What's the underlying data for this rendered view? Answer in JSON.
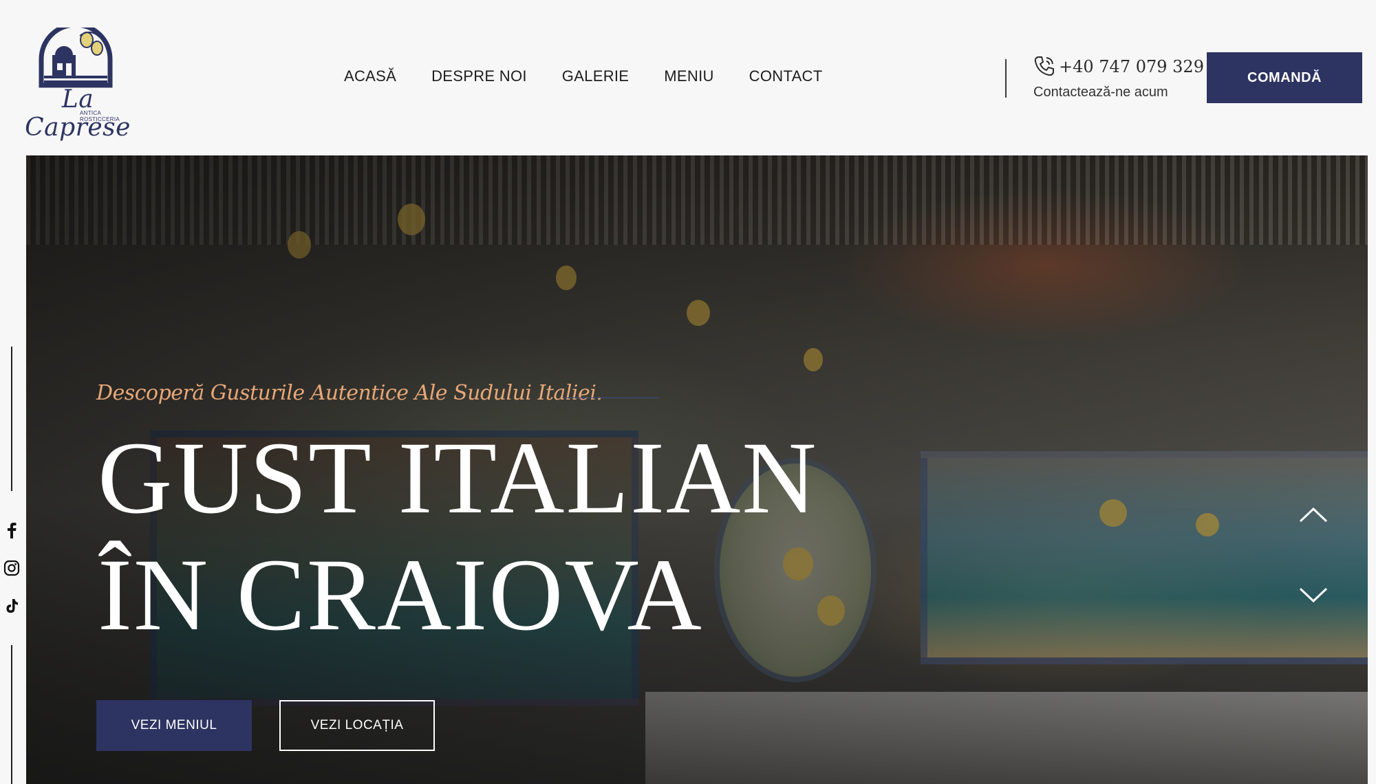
{
  "header": {
    "logo": {
      "brand": "La Caprese",
      "sub": "ANTICA ROSTICCERIA",
      "icon": "lemon-house-emblem"
    },
    "nav": [
      {
        "label": "ACASĂ"
      },
      {
        "label": "DESPRE NOI"
      },
      {
        "label": "GALERIE"
      },
      {
        "label": "MENIU"
      },
      {
        "label": "CONTACT"
      }
    ],
    "contact": {
      "phone": "+40 747 079 329",
      "subtitle": "Contactează-ne acum",
      "icon": "phone-icon"
    },
    "order_button": "COMANDĂ"
  },
  "social": [
    {
      "icon": "facebook-icon"
    },
    {
      "icon": "instagram-icon"
    },
    {
      "icon": "tiktok-icon"
    }
  ],
  "hero": {
    "tagline": "Descoperă Gusturile Autentice Ale Sudului Italiei.",
    "headline_line1": "GUST ITALIAN",
    "headline_line2": "ÎN CRAIOVA",
    "primary_button": "VEZI MENIUL",
    "secondary_button": "VEZI LOCAȚIA",
    "controls": {
      "up": "chevron-up-icon",
      "down": "chevron-down-icon"
    }
  },
  "colors": {
    "brand_navy": "#2d3461",
    "tagline": "#e8a878",
    "background": "#f7f7f8"
  }
}
